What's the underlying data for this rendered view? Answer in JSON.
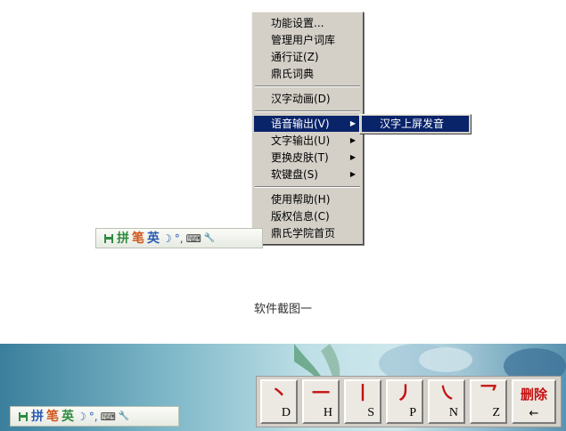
{
  "menu": {
    "items": [
      {
        "label": "功能设置..."
      },
      {
        "label": "管理用户词库"
      },
      {
        "label": "通行证(Z)"
      },
      {
        "label": "鼎氏词典"
      },
      {
        "label": "汉字动画(D)"
      },
      {
        "label": "语音输出(V)"
      },
      {
        "label": "文字输出(U)"
      },
      {
        "label": "更换皮肤(T)"
      },
      {
        "label": "软键盘(S)"
      },
      {
        "label": "使用帮助(H)"
      },
      {
        "label": "版权信息(C)"
      },
      {
        "label": "鼎氏学院首页"
      }
    ],
    "arrow": "▶",
    "submenu": {
      "label": "汉字上屏发音"
    }
  },
  "toolbar": {
    "pin": "拼",
    "bi": "笔",
    "ying": "英",
    "moon": "☽",
    "punct": "°,",
    "keyboard": "⌨",
    "wrench": "🔧"
  },
  "caption": "软件截图一",
  "keypad": {
    "keys": [
      {
        "stroke": "丶",
        "label": "D"
      },
      {
        "stroke": "一",
        "label": "H"
      },
      {
        "stroke": "丨",
        "label": "S"
      },
      {
        "stroke": "丿",
        "label": "P"
      },
      {
        "stroke": "㇏",
        "label": "N"
      },
      {
        "stroke": "乛",
        "label": "Z"
      }
    ],
    "delete": {
      "label": "删除",
      "arrow": "←"
    }
  },
  "colors": {
    "menu_highlight": "#0a246a",
    "stroke_red": "#c41010",
    "menu_bg": "#d4d0c8"
  }
}
